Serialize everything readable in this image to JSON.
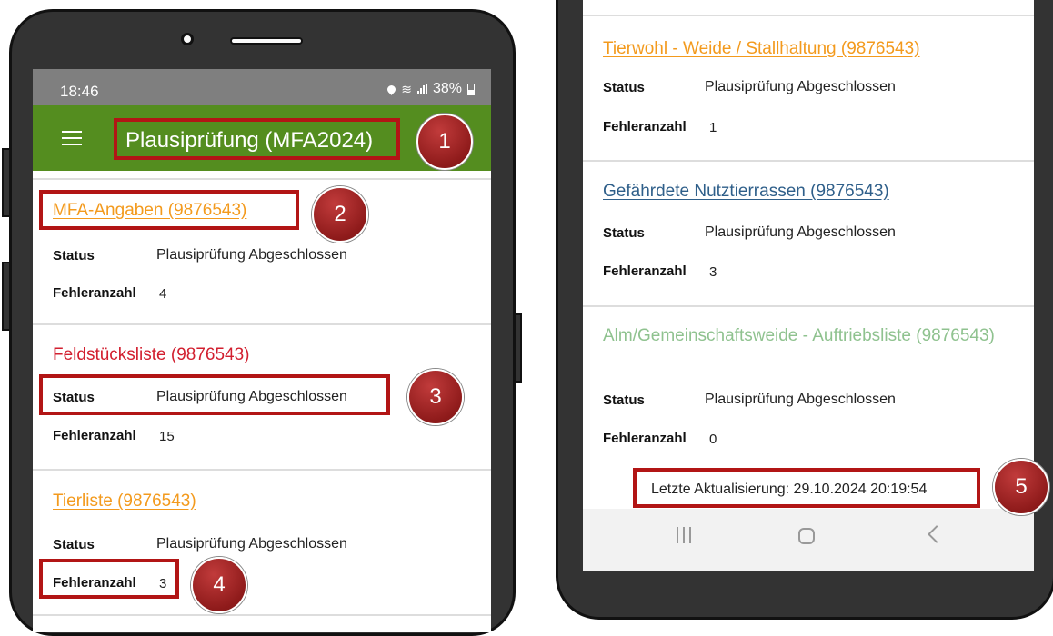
{
  "left_phone": {
    "status_bar": {
      "time": "18:46",
      "battery": "38%"
    },
    "app_bar": {
      "title": "Plausiprüfung (MFA2024)"
    },
    "cards": [
      {
        "title": "MFA-Angaben (9876543)",
        "status_label": "Status",
        "status_value": "Plausiprüfung Abgeschlossen",
        "error_label": "Fehleranzahl",
        "error_value": "4"
      },
      {
        "title": "Feldstücksliste (9876543)",
        "status_label": "Status",
        "status_value": "Plausiprüfung Abgeschlossen",
        "error_label": "Fehleranzahl",
        "error_value": "15"
      },
      {
        "title": "Tierliste (9876543)",
        "status_label": "Status",
        "status_value": "Plausiprüfung Abgeschlossen",
        "error_label": "Fehleranzahl",
        "error_value": "3"
      }
    ]
  },
  "right_phone": {
    "cards": [
      {
        "title": "Tierwohl - Weide / Stallhaltung (9876543)",
        "status_label": "Status",
        "status_value": "Plausiprüfung Abgeschlossen",
        "error_label": "Fehleranzahl",
        "error_value": "1"
      },
      {
        "title": "Gefährdete Nutztierrassen (9876543)",
        "status_label": "Status",
        "status_value": "Plausiprüfung Abgeschlossen",
        "error_label": "Fehleranzahl",
        "error_value": "3"
      },
      {
        "title": "Alm/Gemeinschaftsweide - Auftriebsliste (9876543)",
        "status_label": "Status",
        "status_value": "Plausiprüfung Abgeschlossen",
        "error_label": "Fehleranzahl",
        "error_value": "0"
      }
    ],
    "last_updated": "Letzte Aktualisierung: 29.10.2024 20:19:54"
  },
  "callouts": [
    "1",
    "2",
    "3",
    "4",
    "5"
  ],
  "colors": {
    "app_bar": "#548d1f",
    "status_bar": "#7f7f7f",
    "title_orange": "#f39a1d",
    "title_red": "#d21f2f",
    "title_navy": "#2f5f8a",
    "title_green": "#8fc28f",
    "highlight": "#b21515"
  }
}
